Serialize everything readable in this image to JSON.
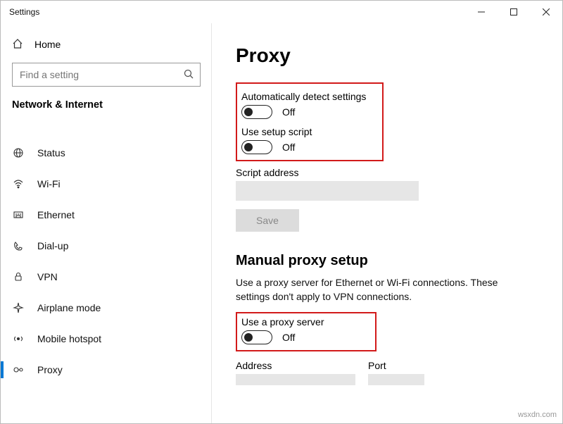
{
  "window": {
    "title": "Settings"
  },
  "sidebar": {
    "home": "Home",
    "search_placeholder": "Find a setting",
    "category": "Network & Internet",
    "items": [
      {
        "label": "Status"
      },
      {
        "label": "Wi-Fi"
      },
      {
        "label": "Ethernet"
      },
      {
        "label": "Dial-up"
      },
      {
        "label": "VPN"
      },
      {
        "label": "Airplane mode"
      },
      {
        "label": "Mobile hotspot"
      },
      {
        "label": "Proxy"
      }
    ]
  },
  "page": {
    "title": "Proxy",
    "auto_detect_label": "Automatically detect settings",
    "auto_detect_state": "Off",
    "use_script_label": "Use setup script",
    "use_script_state": "Off",
    "script_address_label": "Script address",
    "script_address_value": "",
    "save_label": "Save",
    "manual_heading": "Manual proxy setup",
    "manual_desc": "Use a proxy server for Ethernet or Wi-Fi connections. These settings don't apply to VPN connections.",
    "use_proxy_label": "Use a proxy server",
    "use_proxy_state": "Off",
    "address_label": "Address",
    "address_value": "",
    "port_label": "Port",
    "port_value": ""
  },
  "watermark": "wsxdn.com"
}
